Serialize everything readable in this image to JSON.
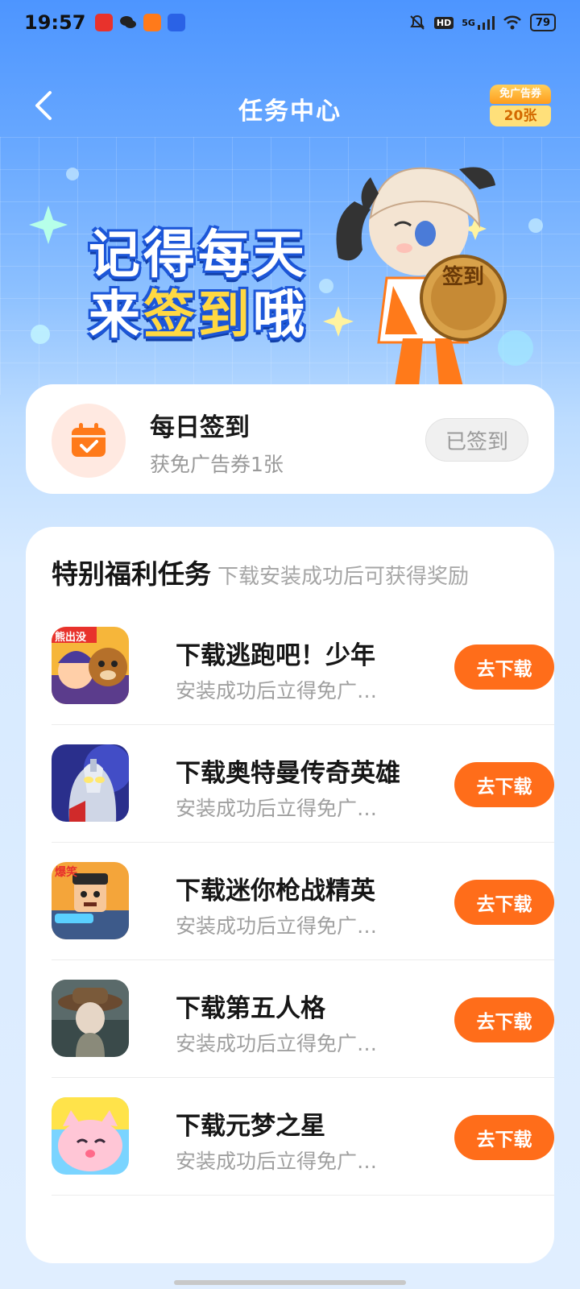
{
  "status_bar": {
    "time": "19:57",
    "network": "5G",
    "hd": "HD",
    "battery": "79"
  },
  "header": {
    "title": "任务中心",
    "coupon_label": "免广告券",
    "coupon_count": "20张"
  },
  "banner": {
    "line1": "记得每天",
    "line2_prefix": "来",
    "line2_highlight": "签到",
    "line2_suffix": "哦",
    "medal_text": "签到"
  },
  "daily_signin": {
    "title": "每日签到",
    "subtitle": "获免广告券1张",
    "button": "已签到"
  },
  "special_tasks": {
    "title": "特别福利任务",
    "hint": "下载安装成功后可获得奖励",
    "items": [
      {
        "title": "下载逃跑吧！少年",
        "subtitle": "安装成功后立得免广…",
        "button": "去下载",
        "icon_text": "熊出没"
      },
      {
        "title": "下载奥特曼传奇英雄",
        "subtitle": "安装成功后立得免广…",
        "button": "去下载"
      },
      {
        "title": "下载迷你枪战精英",
        "subtitle": "安装成功后立得免广…",
        "button": "去下载",
        "icon_text": "爆笑"
      },
      {
        "title": "下载第五人格",
        "subtitle": "安装成功后立得免广…",
        "button": "去下载"
      },
      {
        "title": "下载元梦之星",
        "subtitle": "安装成功后立得免广…",
        "button": "去下载"
      }
    ]
  },
  "colors": {
    "accent": "#ff6d1a",
    "header_blue": "#4d95ff"
  }
}
